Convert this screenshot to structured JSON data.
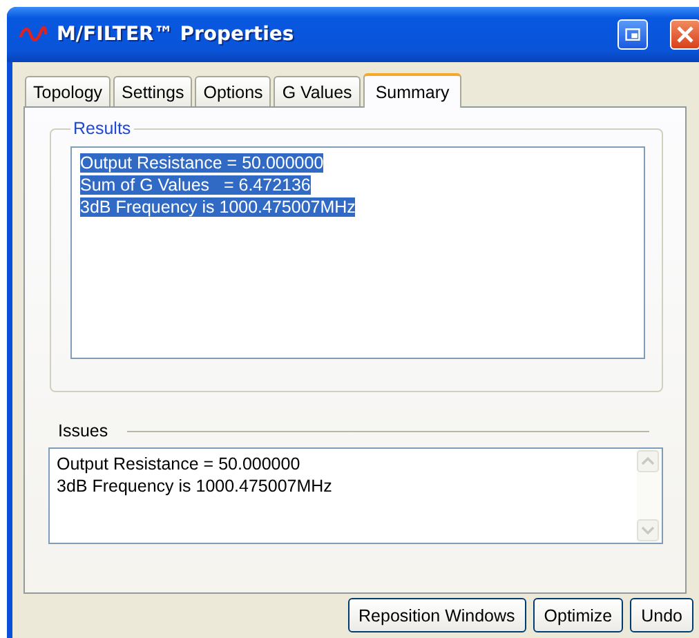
{
  "window": {
    "title": "M/FILTER™ Properties"
  },
  "tabs": [
    {
      "label": "Topology",
      "selected": false
    },
    {
      "label": "Settings",
      "selected": false
    },
    {
      "label": "Options",
      "selected": false
    },
    {
      "label": "G Values",
      "selected": false
    },
    {
      "label": "Summary",
      "selected": true
    }
  ],
  "results": {
    "label": "Results",
    "lines": [
      {
        "text": "Output Resistance = 50.000000",
        "selected": true
      },
      {
        "text": "Sum of G Values   = 6.472136",
        "selected": true
      },
      {
        "text": "3dB Frequency is 1000.475007MHz",
        "selected": true
      }
    ]
  },
  "issues": {
    "label": "Issues",
    "lines": [
      "Output Resistance = 50.000000",
      "3dB Frequency is 1000.475007MHz"
    ]
  },
  "buttons": [
    "Reposition Windows",
    "Optimize",
    "Undo"
  ]
}
